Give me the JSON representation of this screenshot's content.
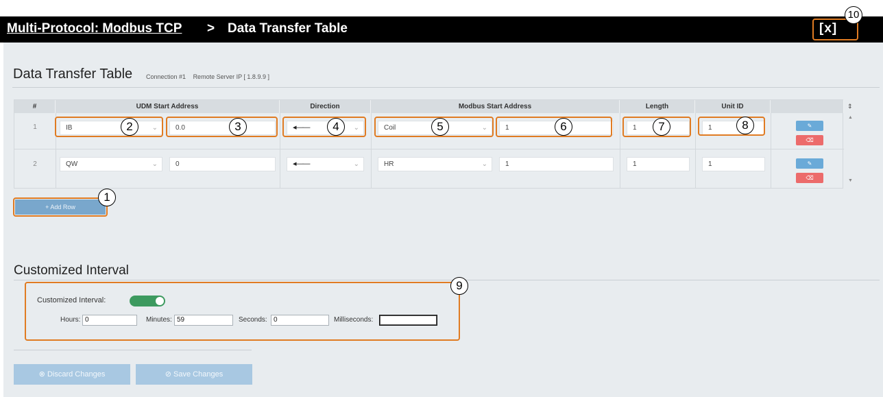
{
  "header": {
    "app_link": "Multi-Protocol: Modbus TCP",
    "separator": ">",
    "current_page": "Data Transfer Table",
    "close_label": "[x]"
  },
  "section": {
    "title": "Data Transfer Table",
    "connection": "Connection #1",
    "remote_ip": "Remote Server IP [ 1.8.9.9 ]"
  },
  "table": {
    "columns": [
      "#",
      "UDM Start Address",
      "Direction",
      "Modbus Start Address",
      "Length",
      "Unit ID"
    ],
    "rows": [
      {
        "num": "1",
        "udm_type": "IB",
        "udm_addr": "0.0",
        "direction": "◂——",
        "modbus_type": "Coil",
        "modbus_addr": "1",
        "length": "1",
        "unit_id": "1"
      },
      {
        "num": "2",
        "udm_type": "QW",
        "udm_addr": "0",
        "direction": "◂——",
        "modbus_type": "HR",
        "modbus_addr": "1",
        "length": "1",
        "unit_id": "1"
      }
    ],
    "edit_icon": "edit-icon",
    "delete_icon": "trash-icon"
  },
  "add_row_label": "+ Add Row",
  "interval": {
    "title": "Customized Interval",
    "toggle_label": "Customized Interval:",
    "toggle_on": true,
    "hours_label": "Hours:",
    "hours_value": "0",
    "minutes_label": "Minutes:",
    "minutes_value": "59",
    "seconds_label": "Seconds:",
    "seconds_value": "0",
    "ms_label": "Milliseconds:",
    "ms_value": ""
  },
  "footer": {
    "discard_label": "⊗ Discard Changes",
    "save_label": "⊘ Save Changes"
  },
  "callouts": [
    "1",
    "2",
    "3",
    "4",
    "5",
    "6",
    "7",
    "8",
    "9",
    "10"
  ],
  "colors": {
    "highlight": "#e07b22",
    "toggle_on": "#3d9a5f",
    "button": "#79a7cc",
    "delete": "#ec6b6b"
  }
}
